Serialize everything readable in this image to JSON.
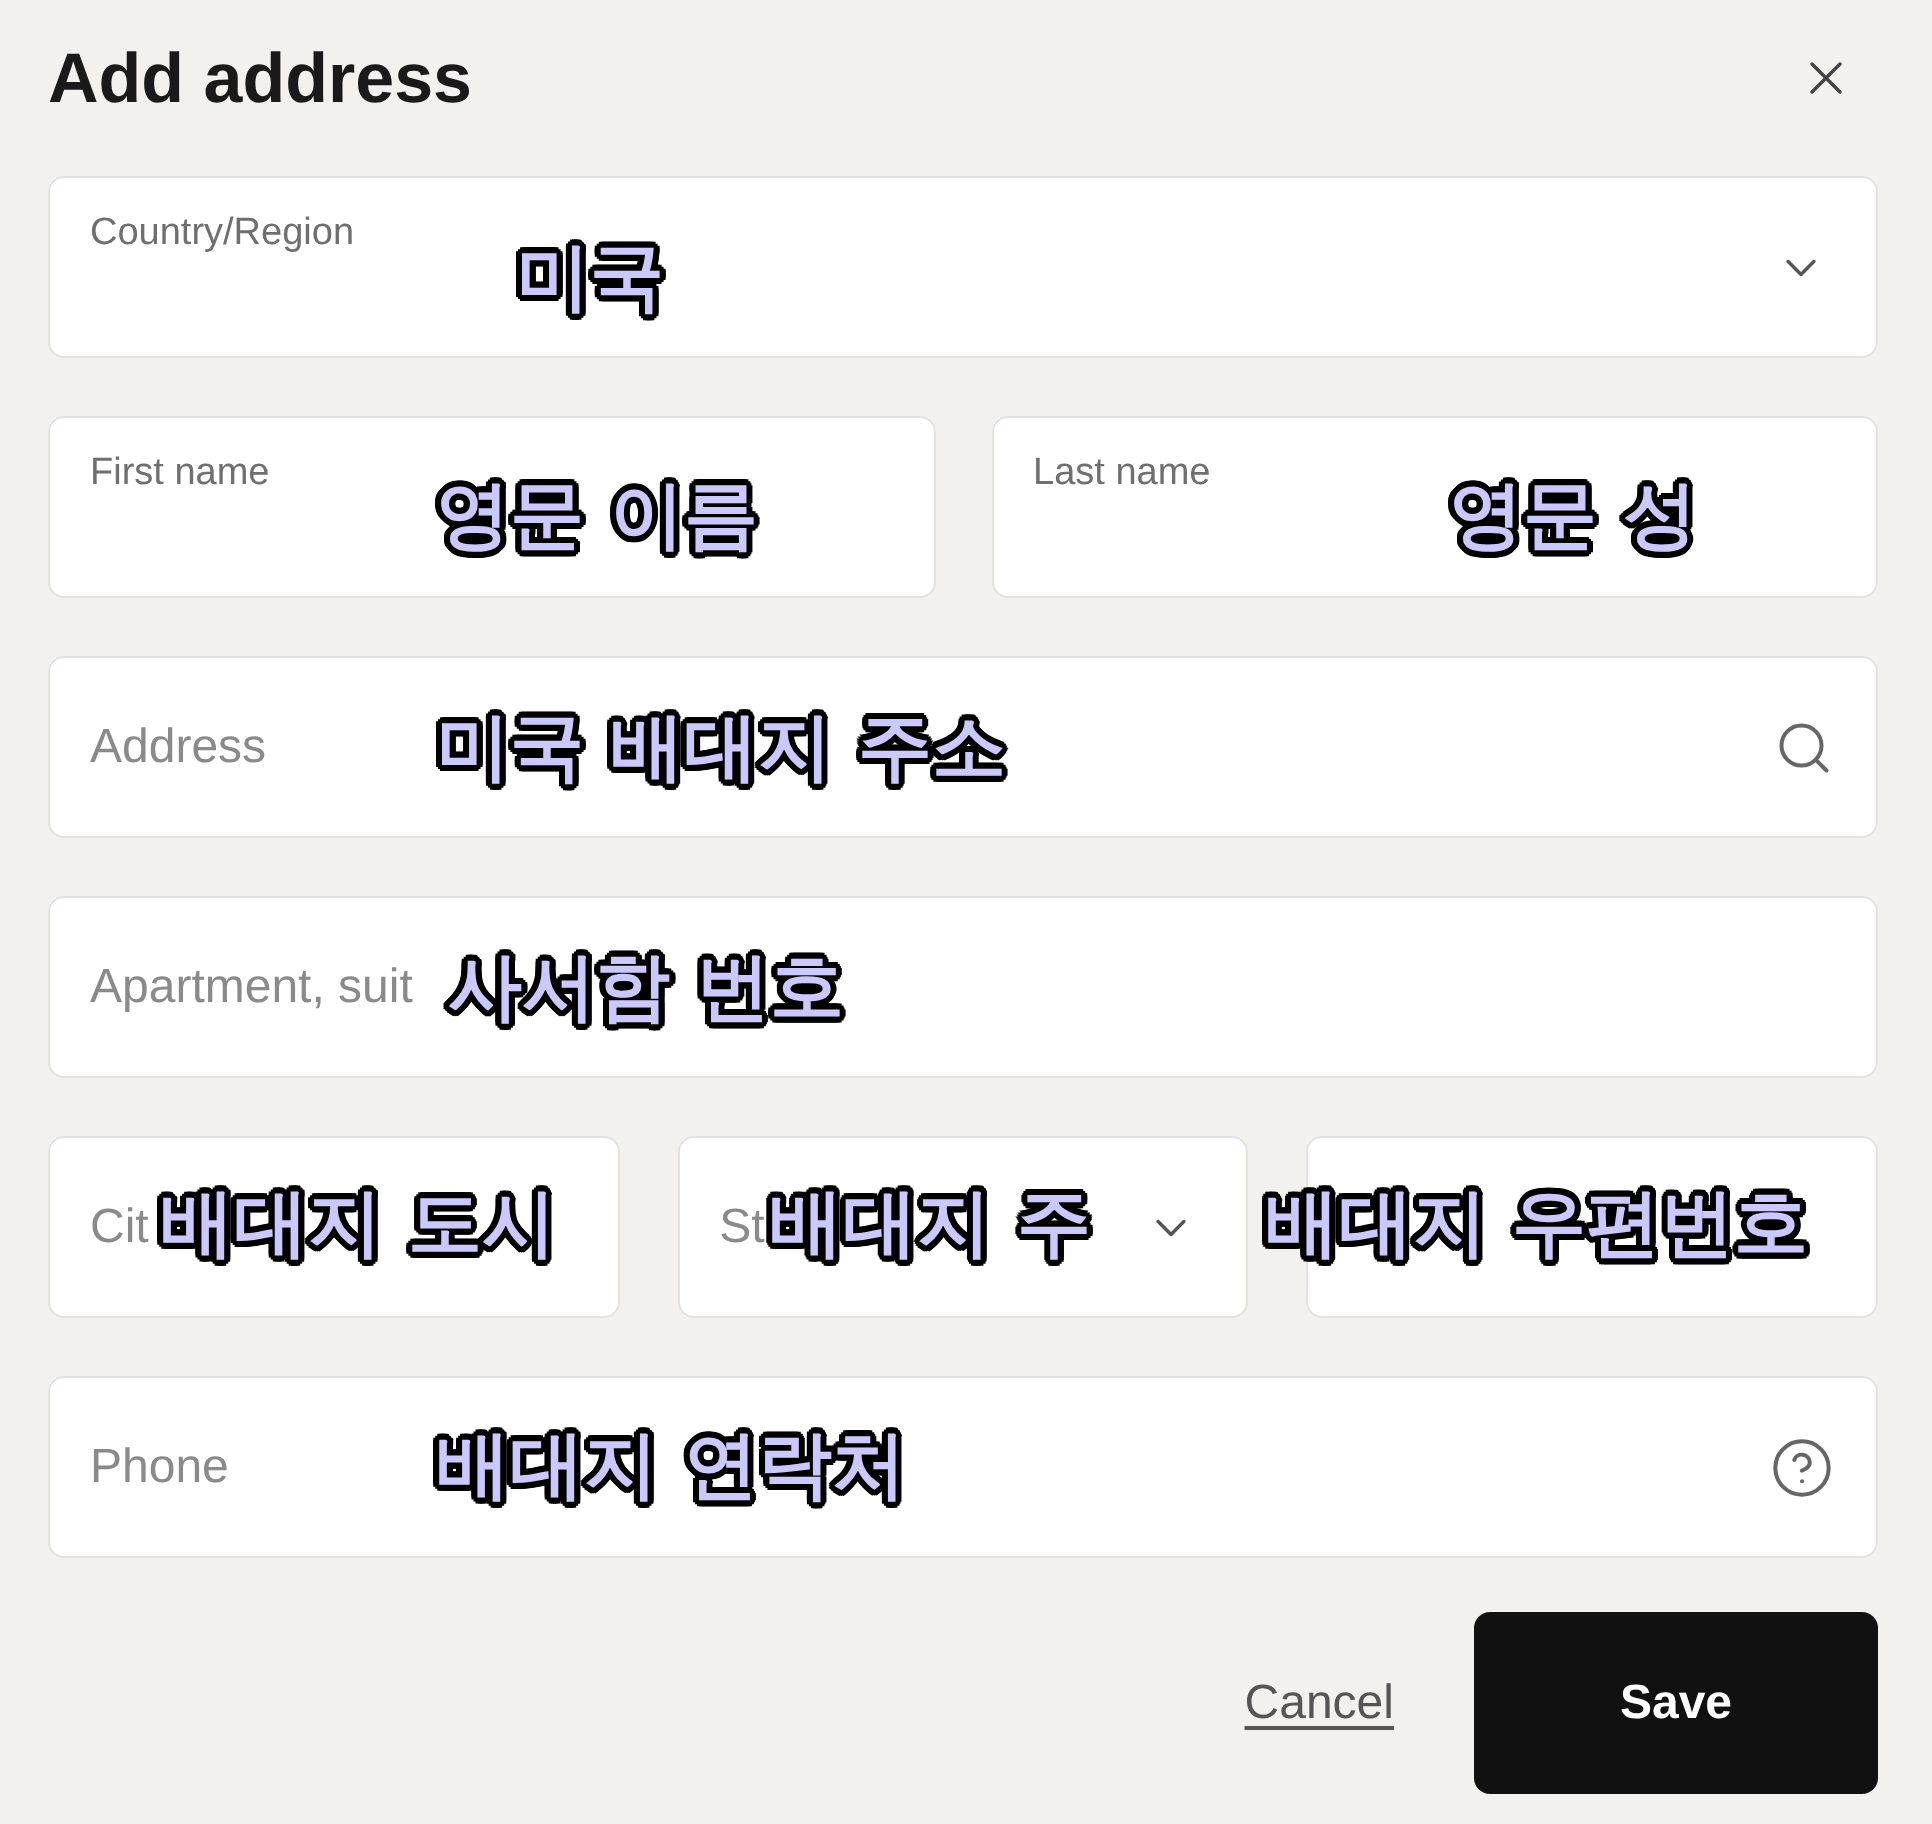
{
  "dialog": {
    "title": "Add address"
  },
  "rows": [
    {
      "fields": [
        {
          "kind": "select",
          "label": "Country/Region",
          "annotation": "미국"
        }
      ]
    },
    {
      "fields": [
        {
          "kind": "text",
          "label": "First name",
          "annotation": "영문 이름"
        },
        {
          "kind": "text",
          "label": "Last name",
          "annotation": "영문 성"
        }
      ]
    },
    {
      "fields": [
        {
          "kind": "search",
          "placeholder": "Address",
          "annotation": "미국 배대지 주소"
        }
      ]
    },
    {
      "fields": [
        {
          "kind": "text",
          "placeholder": "Apartment, suit",
          "annotation": "사서함 번호"
        }
      ]
    },
    {
      "fields": [
        {
          "kind": "text",
          "placeholder": "Cit",
          "annotation": "배대지 도시"
        },
        {
          "kind": "select",
          "placeholder": "St",
          "annotation": "배대지 주"
        },
        {
          "kind": "text",
          "annotation": "배대지 우편번호"
        }
      ]
    },
    {
      "fields": [
        {
          "kind": "help",
          "placeholder": "Phone",
          "annotation": "배대지 연락처"
        }
      ]
    }
  ],
  "buttons": [
    {
      "kind": "link",
      "label": "Cancel"
    },
    {
      "kind": "primary",
      "label": "Save"
    }
  ]
}
